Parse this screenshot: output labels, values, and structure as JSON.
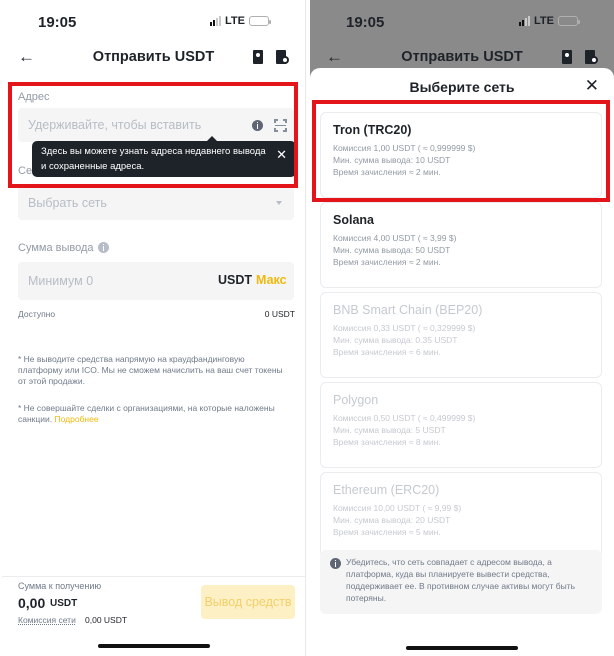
{
  "status": {
    "time": "19:05",
    "network": "LTE"
  },
  "screen": {
    "title": "Отправить USDT",
    "icons": {
      "back": "arrow-left-icon",
      "address_book": "address-book-icon",
      "history": "history-icon"
    }
  },
  "address": {
    "label": "Адрес",
    "placeholder": "Удерживайте, чтобы вставить",
    "tooltip": "Здесь вы можете узнать адреса недавнего вывода и сохраненные адреса.",
    "tooltip_hidden_label": "Се"
  },
  "network": {
    "placeholder": "Выбрать сеть"
  },
  "amount": {
    "label": "Сумма вывода",
    "placeholder": "Минимум 0",
    "currency": "USDT",
    "max_label": "Макс",
    "available_label": "Доступно",
    "available_value": "0 USDT"
  },
  "notes": {
    "note1": "* Не выводите средства напрямую на краудфандинговую платформу или ICO. Мы не сможем начислить на ваш счет токены от этой продажи.",
    "note2": "* Не совершайте сделки с организациями, на которые наложены санкции.",
    "note2_link": "Подробнее"
  },
  "footer": {
    "receive_label": "Сумма к получению",
    "receive_amount": "0,00",
    "receive_currency": "USDT",
    "fee_label": "Комиссия сети",
    "fee_value": "0,00 USDT",
    "withdraw_button": "Вывод средств"
  },
  "sheet": {
    "title": "Выберите сеть",
    "networks": [
      {
        "name": "Tron (TRC20)",
        "fee": "Комиссия 1,00 USDT ( ≈ 0,999999 $)",
        "min": "Мин. сумма вывода: 10 USDT",
        "time": "Время зачисления ≈ 2 мин.",
        "enabled": true
      },
      {
        "name": "Solana",
        "fee": "Комиссия 4,00 USDT ( ≈ 3,99 $)",
        "min": "Мин. сумма вывода: 50 USDT",
        "time": "Время зачисления ≈ 2 мин.",
        "enabled": true
      },
      {
        "name": "BNB Smart Chain (BEP20)",
        "fee": "Комиссия 0,33 USDT ( ≈ 0,329999 $)",
        "min": "Мин. сумма вывода: 0.35 USDT",
        "time": "Время зачисления ≈ 6 мин.",
        "enabled": false
      },
      {
        "name": "Polygon",
        "fee": "Комиссия 0,50 USDT ( ≈ 0,499999 $)",
        "min": "Мин. сумма вывода: 5 USDT",
        "time": "Время зачисления ≈ 8 мин.",
        "enabled": false
      },
      {
        "name": "Ethereum (ERC20)",
        "fee": "Комиссия 10,00 USDT ( ≈ 9,99 $)",
        "min": "Мин. сумма вывода: 20 USDT",
        "time": "Время зачисления ≈ 5 мин.",
        "enabled": false
      }
    ],
    "notice": "Убедитесь, что сеть совпадает с адресом вывода, а платформа, куда вы планируете вывести средства, поддерживает ее. В противном случае активы могут быть потеряны."
  },
  "colors": {
    "accent": "#f0b90b",
    "highlight": "#e4141b",
    "text": "#1e2329",
    "muted": "#929aa5"
  }
}
